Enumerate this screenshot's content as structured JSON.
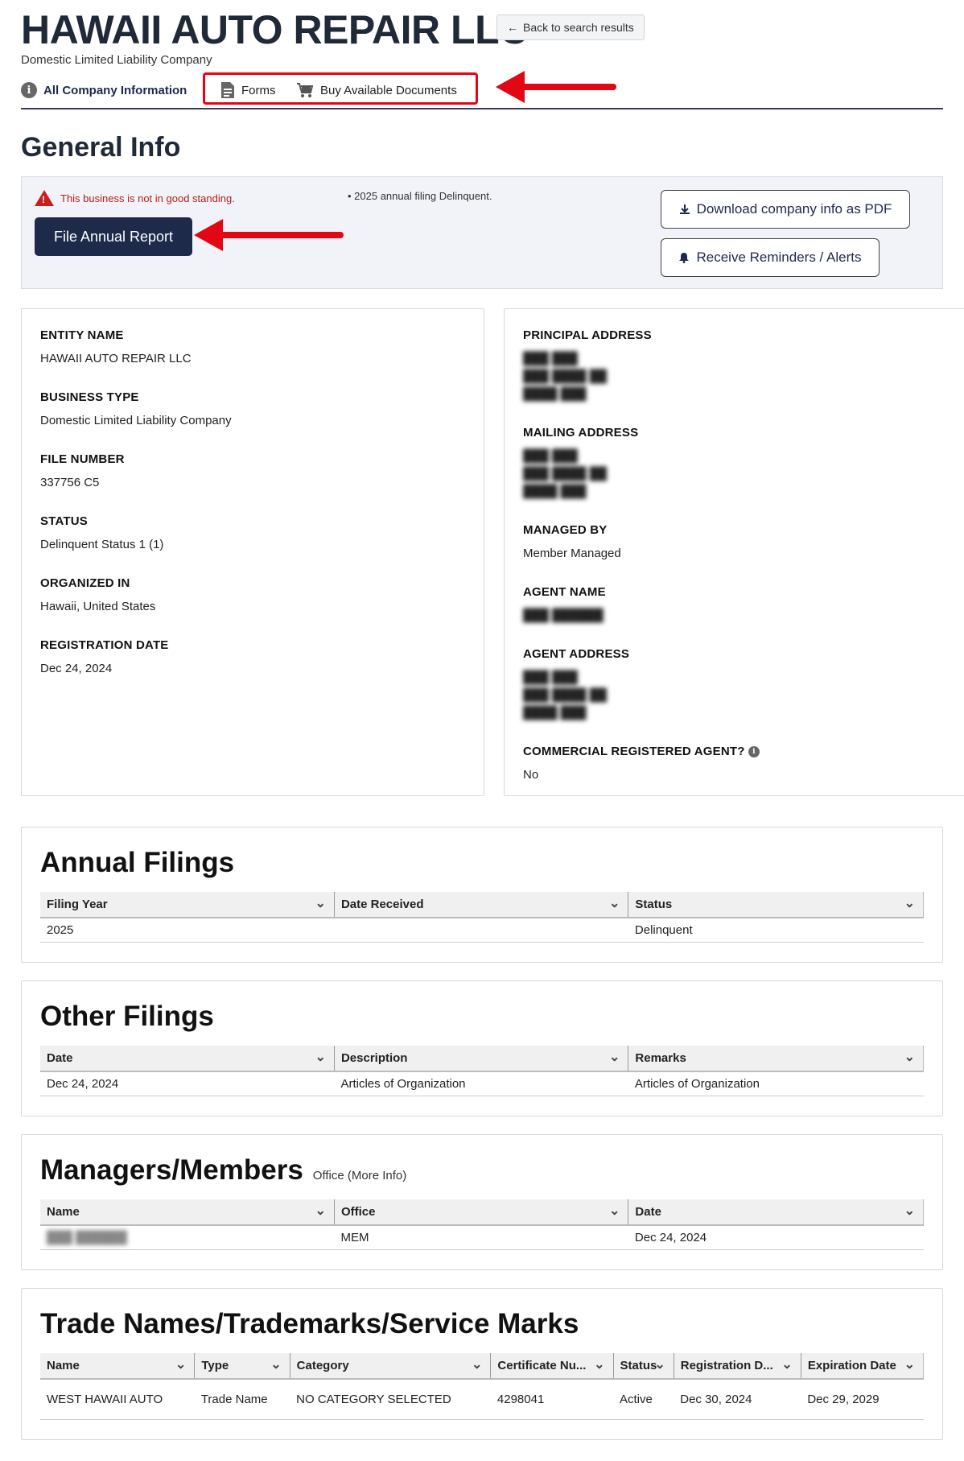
{
  "header": {
    "title": "HAWAII AUTO REPAIR LLC",
    "subtitle": "Domestic Limited Liability Company",
    "back_label": "Back to search results"
  },
  "tabs": [
    {
      "label": "All Company Information",
      "icon": "info-icon"
    },
    {
      "label": "Forms",
      "icon": "document-icon"
    },
    {
      "label": "Buy Available Documents",
      "icon": "cart-icon"
    }
  ],
  "general_info": {
    "heading": "General Info",
    "warning": "This business is not in good standing.",
    "note": "• 2025 annual filing Delinquent.",
    "file_button": "File Annual Report",
    "pdf_button": "Download company info as PDF",
    "reminders_button": "Receive Reminders / Alerts"
  },
  "left_fields": [
    {
      "label": "ENTITY NAME",
      "value": "HAWAII AUTO REPAIR LLC"
    },
    {
      "label": "BUSINESS TYPE",
      "value": "Domestic Limited Liability Company"
    },
    {
      "label": "FILE NUMBER",
      "value": "337756 C5"
    },
    {
      "label": "STATUS",
      "value": "Delinquent Status 1 (1)"
    },
    {
      "label": "ORGANIZED IN",
      "value": "Hawaii, United States"
    },
    {
      "label": "REGISTRATION DATE",
      "value": "Dec 24, 2024"
    }
  ],
  "right_fields": {
    "principal_label": "PRINCIPAL ADDRESS",
    "mailing_label": "MAILING ADDRESS",
    "managed_label": "MANAGED BY",
    "managed_value": "Member Managed",
    "agent_name_label": "AGENT NAME",
    "agent_address_label": "AGENT ADDRESS",
    "commercial_label": "COMMERCIAL REGISTERED AGENT?",
    "commercial_value": "No"
  },
  "annual_filings": {
    "title": "Annual Filings",
    "columns": [
      "Filing Year",
      "Date Received",
      "Status"
    ],
    "rows": [
      [
        "2025",
        "",
        "Delinquent"
      ]
    ]
  },
  "other_filings": {
    "title": "Other Filings",
    "columns": [
      "Date",
      "Description",
      "Remarks"
    ],
    "rows": [
      [
        "Dec 24, 2024",
        "Articles of Organization",
        "Articles of Organization"
      ]
    ]
  },
  "managers": {
    "title": "Managers/Members",
    "sub": "Office (More Info)",
    "columns": [
      "Name",
      "Office",
      "Date"
    ],
    "rows": [
      [
        "",
        "MEM",
        "Dec 24, 2024"
      ]
    ]
  },
  "trade_names": {
    "title": "Trade Names/Trademarks/Service Marks",
    "columns": [
      "Name",
      "Type",
      "Category",
      "Certificate Nu...",
      "Status",
      "Registration D...",
      "Expiration Date"
    ],
    "rows": [
      [
        "WEST HAWAII AUTO",
        "Trade Name",
        "NO CATEGORY SELECTED",
        "4298041",
        "Active",
        "Dec 30, 2024",
        "Dec 29, 2029"
      ]
    ]
  },
  "colors": {
    "navy": "#1e2a4a",
    "alert_red": "#e30613",
    "warning_red": "#b91c1c"
  }
}
